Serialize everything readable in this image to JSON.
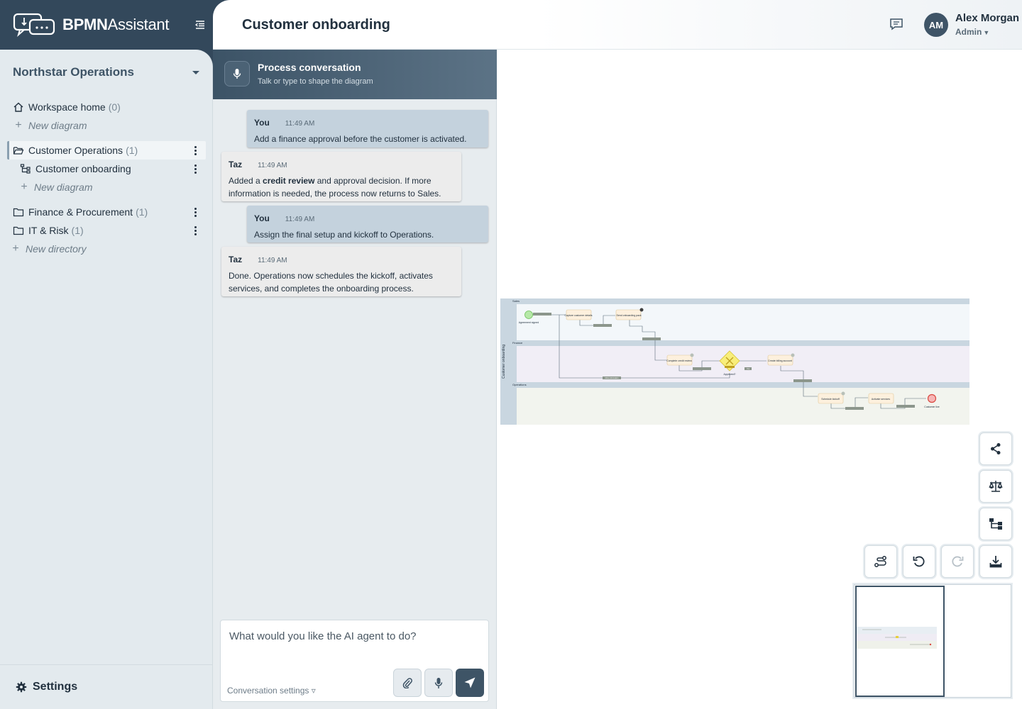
{
  "app": {
    "brand_bold": "BPMN",
    "brand_rest": "Assistant",
    "page_title": "Customer onboarding"
  },
  "user": {
    "initials": "AM",
    "name": "Alex Morgan",
    "role": "Admin"
  },
  "sidebar": {
    "workspace": "Northstar Operations",
    "items": [
      {
        "label": "Workspace home",
        "count": "(0)"
      },
      {
        "label": "New diagram"
      },
      {
        "label": "Customer Operations",
        "count": "(1)"
      },
      {
        "label": "Customer onboarding"
      },
      {
        "label": "New diagram"
      },
      {
        "label": "Finance & Procurement",
        "count": "(1)"
      },
      {
        "label": "IT & Risk",
        "count": "(1)"
      },
      {
        "label": "New directory"
      }
    ],
    "settings": "Settings"
  },
  "chat": {
    "title": "Process conversation",
    "subtitle": "Talk or type to shape the diagram",
    "messages": [
      {
        "who": "You",
        "time": "11:49 AM",
        "text": "Add a finance approval before the customer is activated."
      },
      {
        "who": "Taz",
        "time": "11:49 AM",
        "text_pre": "Added a ",
        "text_bold": "credit review",
        "text_post": " and approval decision. If more information is needed, the process now returns to Sales."
      },
      {
        "who": "You",
        "time": "11:49 AM",
        "text": "Assign the final setup and kickoff to Operations."
      },
      {
        "who": "Taz",
        "time": "11:49 AM",
        "text": "Done. Operations now schedules the kickoff, activates services, and completes the onboarding process."
      }
    ],
    "placeholder": "What would you like the AI agent to do?",
    "conversation_settings": "Conversation settings ▿"
  },
  "diagram": {
    "pool": "Customer onboarding",
    "lanes": [
      "Sales",
      "Finance",
      "Operations"
    ],
    "start_event": "Agreement signed",
    "tasks": [
      "Capture customer details",
      "Send onboarding pack",
      "Complete credit review",
      "Create billing account",
      "Schedule kickoff",
      "Activate services"
    ],
    "gateway": "Approved?",
    "end_event": "Customer live",
    "flows": [
      "More information",
      "Yes"
    ]
  },
  "icons": {
    "logo": "chat-logo-icon",
    "collapse": "sidebar-collapse-icon",
    "chat": "chat-bubble-icon",
    "share": "share-icon",
    "compare": "balance-icon",
    "hierarchy": "hierarchy-icon",
    "route": "route-icon",
    "undo": "undo-icon",
    "redo": "redo-icon",
    "download": "download-icon"
  }
}
